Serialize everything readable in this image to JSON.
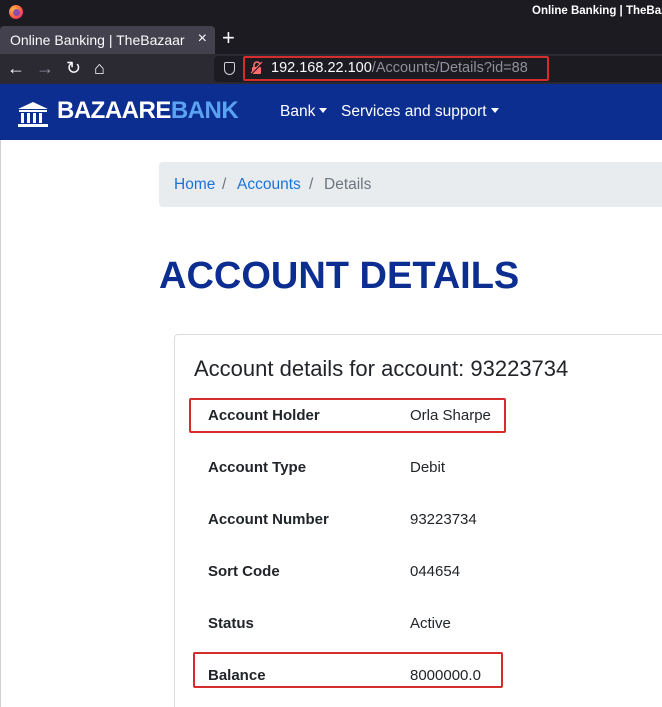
{
  "browser": {
    "window_title": "Online Banking | TheBaz",
    "tab_title": "Online Banking | TheBazaare",
    "tab_close": "×",
    "new_tab": "+",
    "url_host": "192.168.22.100",
    "url_path": "/Accounts/Details?id=88",
    "icons": [
      "firefox-logo-icon",
      "back-icon",
      "forward-icon",
      "reload-icon",
      "home-icon",
      "shield-icon",
      "insecure-lock-icon"
    ],
    "nav_glyphs": {
      "back": "←",
      "forward": "→",
      "reload": "↻",
      "home": "⌂",
      "lock": "🔓"
    }
  },
  "site": {
    "brand_main": "BAZAARE",
    "brand_accent": "BANK",
    "nav": [
      {
        "label": "Bank"
      },
      {
        "label": "Services and support"
      }
    ],
    "colors": {
      "header_bg": "#0d2e91",
      "brand_accent": "#5aa3f2",
      "link": "#1d72d8",
      "title": "#0d2e91",
      "highlight": "#d62c2c"
    }
  },
  "breadcrumb": {
    "home": "Home",
    "accounts": "Accounts",
    "details": "Details",
    "separator": "/"
  },
  "page": {
    "title": "ACCOUNT DETAILS",
    "card_title": "Account details for account: 93223734",
    "rows": [
      {
        "label": "Account Holder",
        "value": "Orla Sharpe"
      },
      {
        "label": "Account Type",
        "value": "Debit"
      },
      {
        "label": "Account Number",
        "value": "93223734"
      },
      {
        "label": "Sort Code",
        "value": "044654"
      },
      {
        "label": "Status",
        "value": "Active"
      },
      {
        "label": "Balance",
        "value": "8000000.0"
      }
    ]
  }
}
